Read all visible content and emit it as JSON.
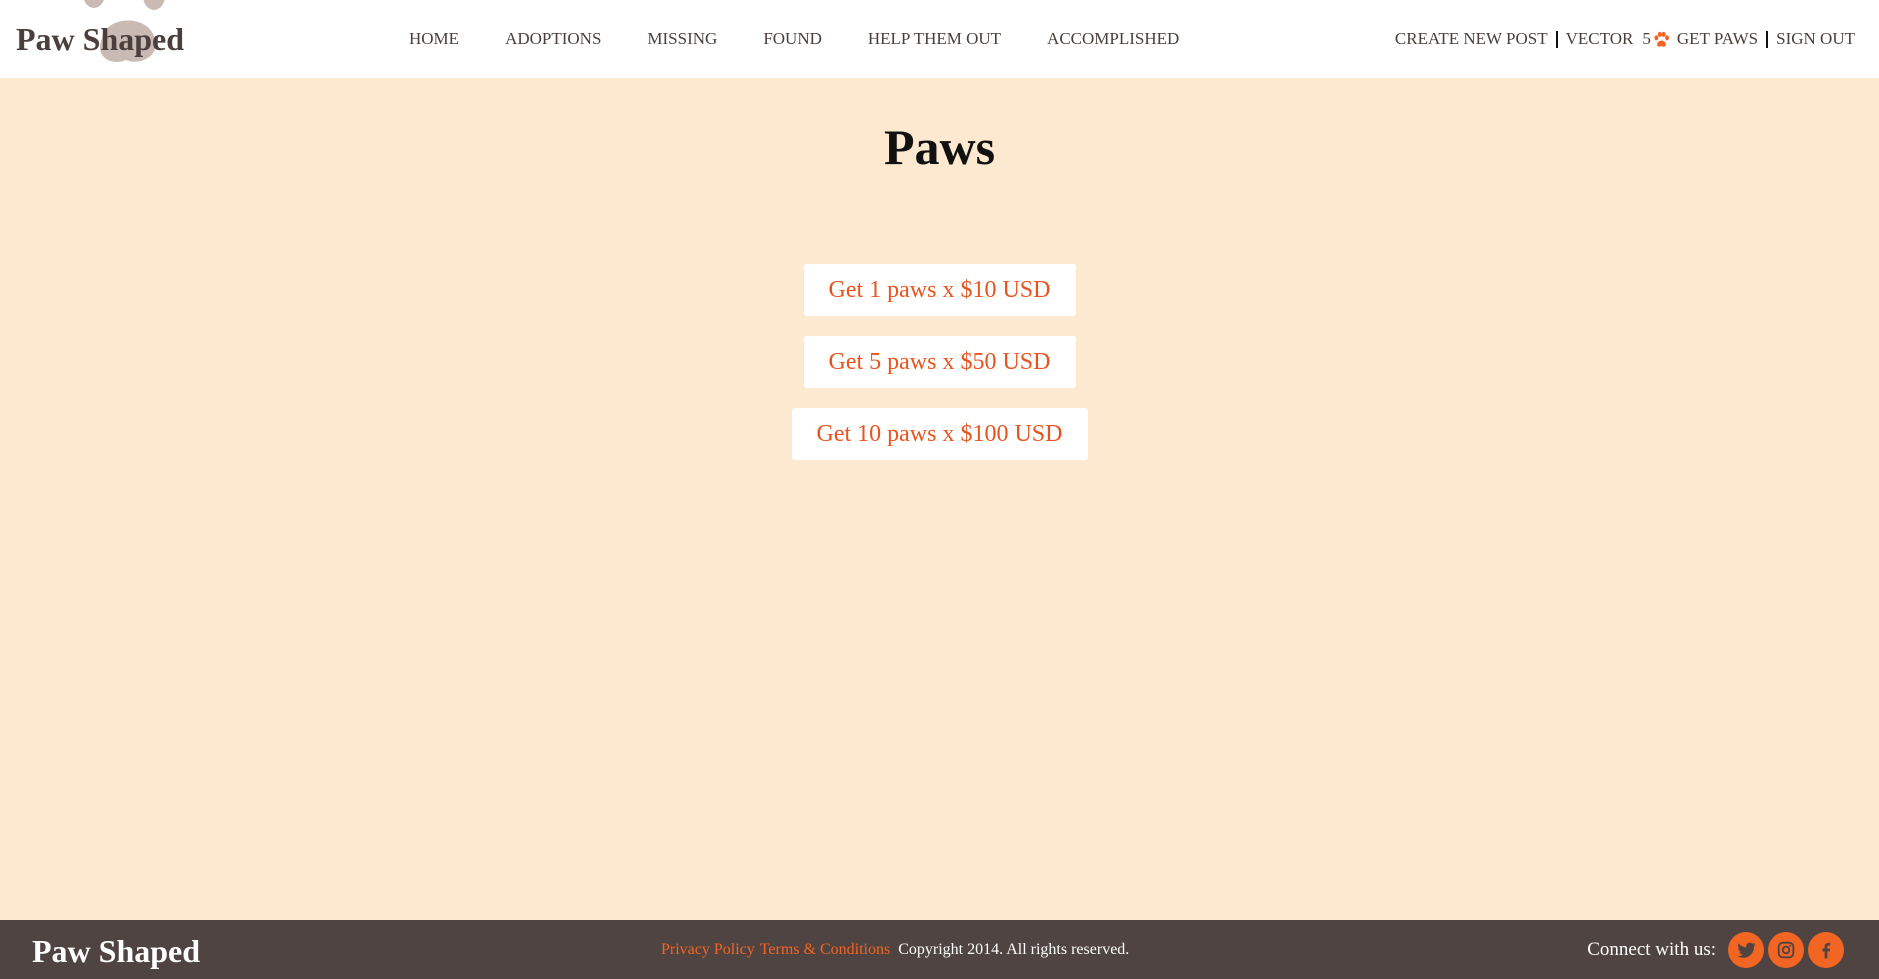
{
  "header": {
    "brand": "Paw Shaped",
    "nav": [
      {
        "label": "HOME"
      },
      {
        "label": "ADOPTIONS"
      },
      {
        "label": "MISSING"
      },
      {
        "label": "FOUND"
      },
      {
        "label": "HELP THEM OUT"
      },
      {
        "label": "ACCOMPLISHED"
      }
    ],
    "user_menu": {
      "create_post": "CREATE NEW POST",
      "username": "VECTOR",
      "paw_count": "5",
      "paw_icon": "paw-icon",
      "get_paws": "GET PAWS",
      "sign_out": "SIGN OUT"
    }
  },
  "main": {
    "title": "Paws",
    "packages": [
      {
        "label": "Get 1 paws x $10 USD"
      },
      {
        "label": "Get 5 paws x $50 USD"
      },
      {
        "label": "Get 10 paws x $100 USD"
      }
    ]
  },
  "footer": {
    "brand": "Paw Shaped",
    "privacy": "Privacy Policy",
    "terms": "Terms & Conditions",
    "copyright": "Copyright 2014. All rights reserved.",
    "connect_label": "Connect with us:",
    "social": [
      {
        "icon": "twitter-icon"
      },
      {
        "icon": "instagram-icon"
      },
      {
        "icon": "facebook-icon"
      }
    ]
  },
  "colors": {
    "page_background": "#fde8d0",
    "accent": "#f26522",
    "text_dark": "#4a3f3c",
    "footer_background": "#4f4441",
    "logo_paw": "#c9bbb4"
  }
}
